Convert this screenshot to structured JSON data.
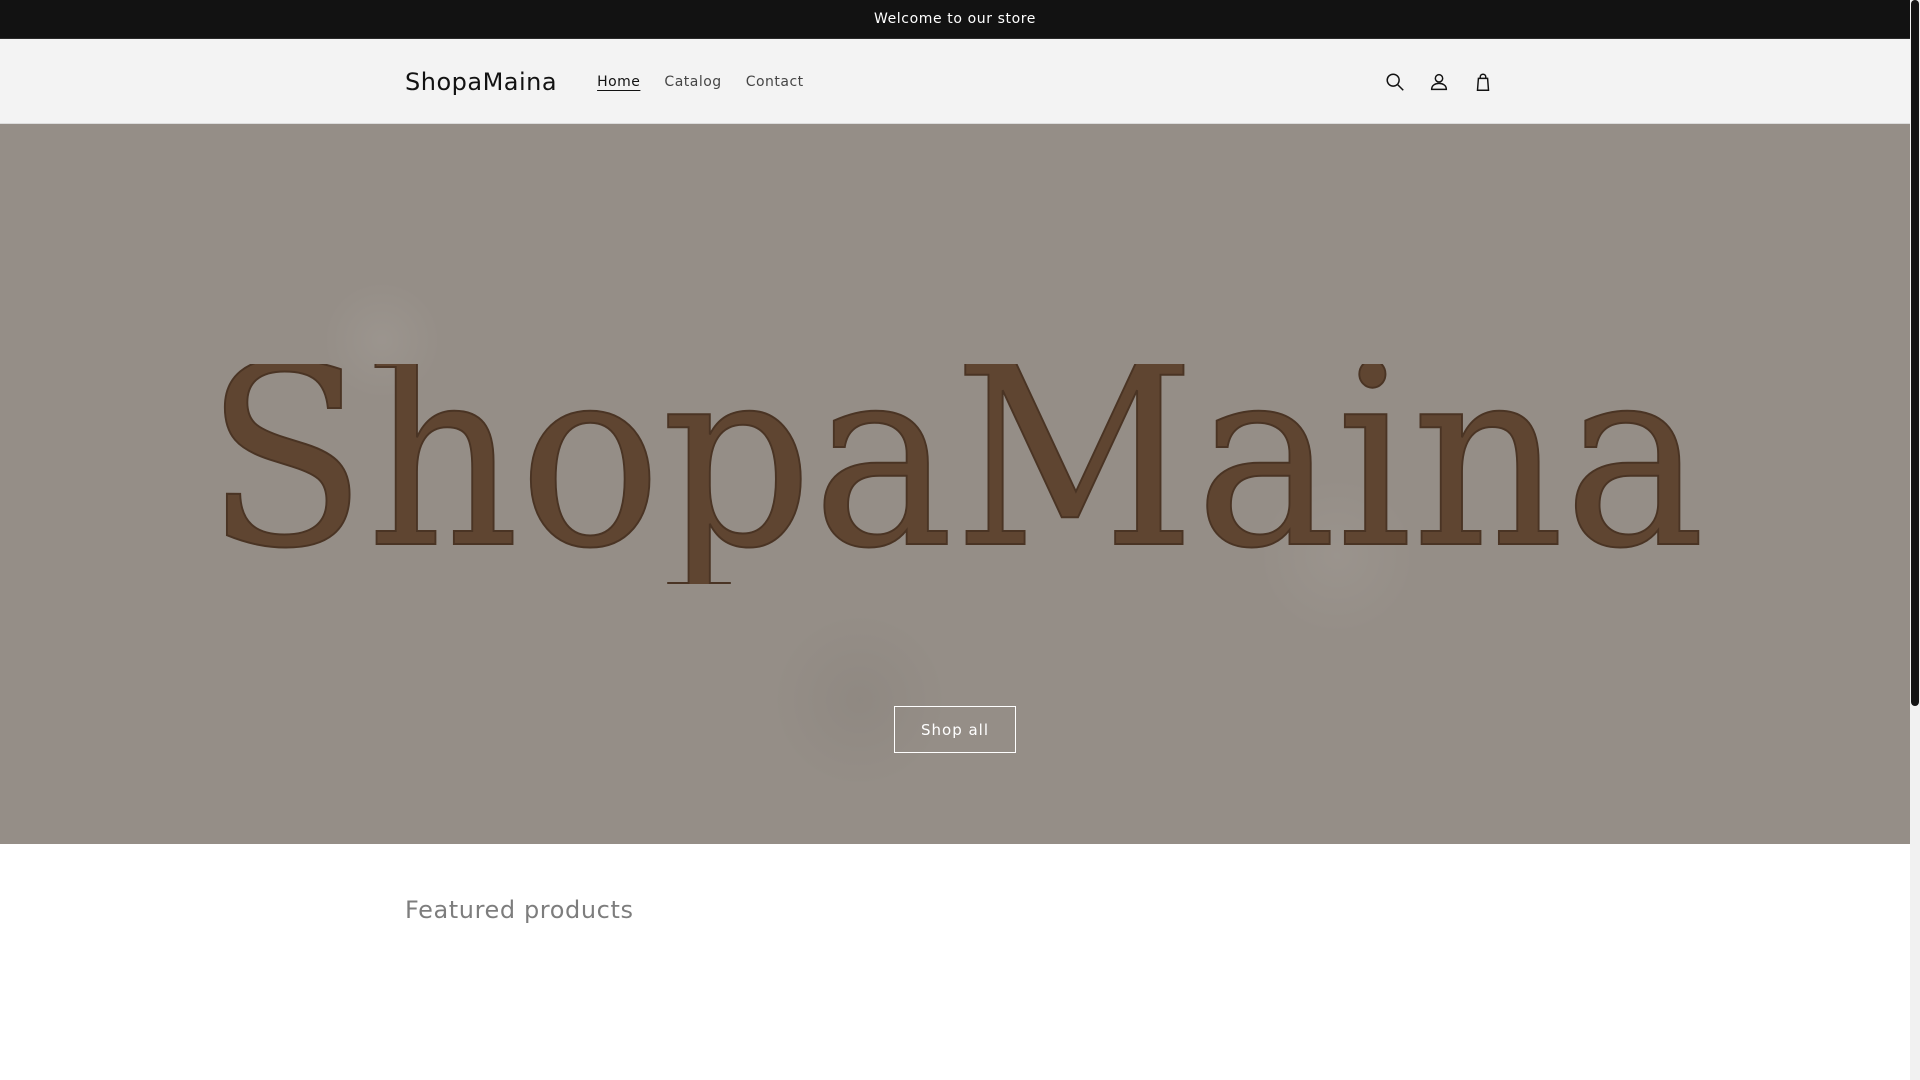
{
  "announcement": {
    "text": "Welcome to our store"
  },
  "header": {
    "logo": "ShopaMaina",
    "nav": [
      {
        "label": "Home",
        "active": true
      },
      {
        "label": "Catalog",
        "active": false
      },
      {
        "label": "Contact",
        "active": false
      }
    ],
    "icons": [
      "search-icon",
      "account-icon",
      "cart-icon"
    ]
  },
  "hero": {
    "logo_text": "ShopaMaina",
    "button_label": "Shop all",
    "background_color": "#958e87",
    "logo_color": "#5f4531"
  },
  "featured": {
    "title": "Featured products"
  },
  "colors": {
    "announcement_bg": "#121212",
    "header_bg": "#f3f3f3",
    "text_primary": "#121212"
  }
}
